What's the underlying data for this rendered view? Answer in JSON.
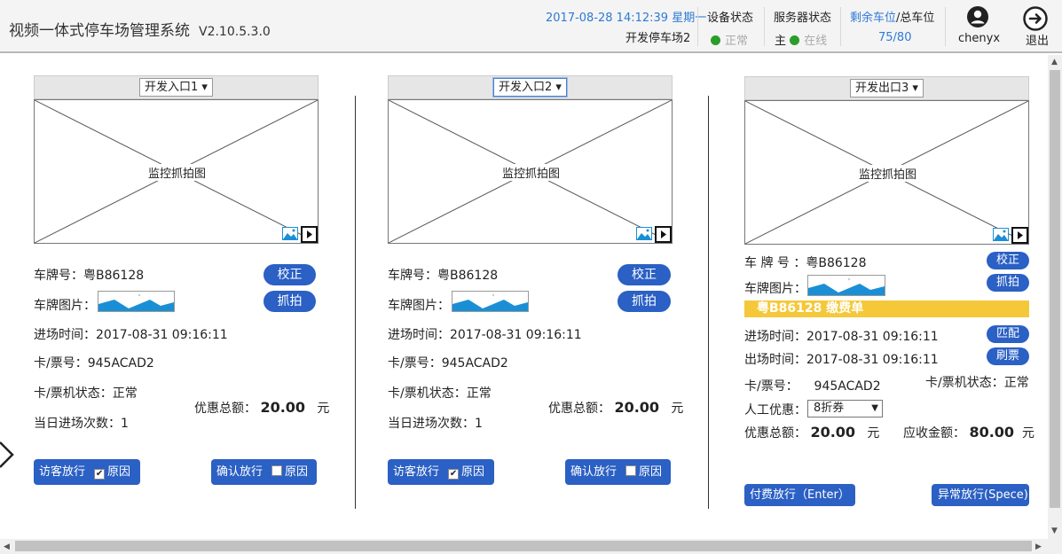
{
  "header": {
    "app_title": "视频一体式停车场管理系统",
    "version": "V2.10.5.3.0",
    "datetime": "2017-08-28 14:12:39 星期一",
    "lot_name": "开发停车场2",
    "device_status_label": "设备状态",
    "device_status_value": "正常",
    "server_status_label": "服务器状态",
    "server_role": "主",
    "server_status_value": "在线",
    "spaces_label_a": "剩余车位",
    "spaces_label_b": "/总车位",
    "spaces_value": "75/80",
    "user": "chenyx",
    "logout": "退出",
    "colors": {
      "accent": "#2e7ad6",
      "online": "#2a9d2a"
    }
  },
  "panels": [
    {
      "channel": "开发入口1",
      "image_caption": "监控抓拍图",
      "plate_label": "车牌号：",
      "plate": "粤B86128",
      "plate_img_label": "车牌图片：",
      "entry_time_label": "进场时间：",
      "entry_time": "2017-08-31 09:16:11",
      "ticket_label": "卡/票号：",
      "ticket": "945ACAD2",
      "machine_status_label": "卡/票机状态：",
      "machine_status": "正常",
      "visits_label": "当日进场次数：",
      "visits": "1",
      "discount_label": "优惠总额：",
      "discount": "20.00",
      "unit": "元",
      "correct_btn": "校正",
      "capture_btn": "抓拍",
      "visitor_btn": "访客放行",
      "visitor_reason": "原因",
      "visitor_checked": true,
      "confirm_btn": "确认放行",
      "confirm_reason": "原因",
      "confirm_checked": false
    },
    {
      "channel": "开发入口2",
      "image_caption": "监控抓拍图",
      "plate_label": "车牌号：",
      "plate": "粤B86128",
      "plate_img_label": "车牌图片：",
      "entry_time_label": "进场时间：",
      "entry_time": "2017-08-31 09:16:11",
      "ticket_label": "卡/票号：",
      "ticket": "945ACAD2",
      "machine_status_label": "卡/票机状态：",
      "machine_status": "正常",
      "visits_label": "当日进场次数：",
      "visits": "1",
      "discount_label": "优惠总额：",
      "discount": "20.00",
      "unit": "元",
      "correct_btn": "校正",
      "capture_btn": "抓拍",
      "visitor_btn": "访客放行",
      "visitor_reason": "原因",
      "visitor_checked": true,
      "confirm_btn": "确认放行",
      "confirm_reason": "原因",
      "confirm_checked": false
    },
    {
      "channel": "开发出口3",
      "image_caption": "监控抓拍图",
      "plate_label": "车 牌 号 ：",
      "plate": "粤B86128",
      "plate_img_label": "车牌图片：",
      "banner": "粤B86128  缴费单",
      "entry_time_label": "进场时间：",
      "entry_time": "2017-08-31 09:16:11",
      "exit_time_label": "出场时间：",
      "exit_time": "2017-08-31 09:16:11",
      "ticket_label": "卡/票号：",
      "ticket": "945ACAD2",
      "machine_status_label": "卡/票机状态：",
      "machine_status": "正常",
      "manual_discount_label": "人工优惠：",
      "manual_discount": "8折券",
      "discount_label": "优惠总额：",
      "discount": "20.00",
      "receivable_label": "应收金额：",
      "receivable": "80.00",
      "unit": "元",
      "correct_btn": "校正",
      "capture_btn": "抓拍",
      "match_btn": "匹配",
      "swipe_btn": "刷票",
      "pay_btn": "付费放行（Enter）",
      "abnormal_btn": "异常放行(Spece)",
      "banner_color": "#f5c83a"
    }
  ]
}
